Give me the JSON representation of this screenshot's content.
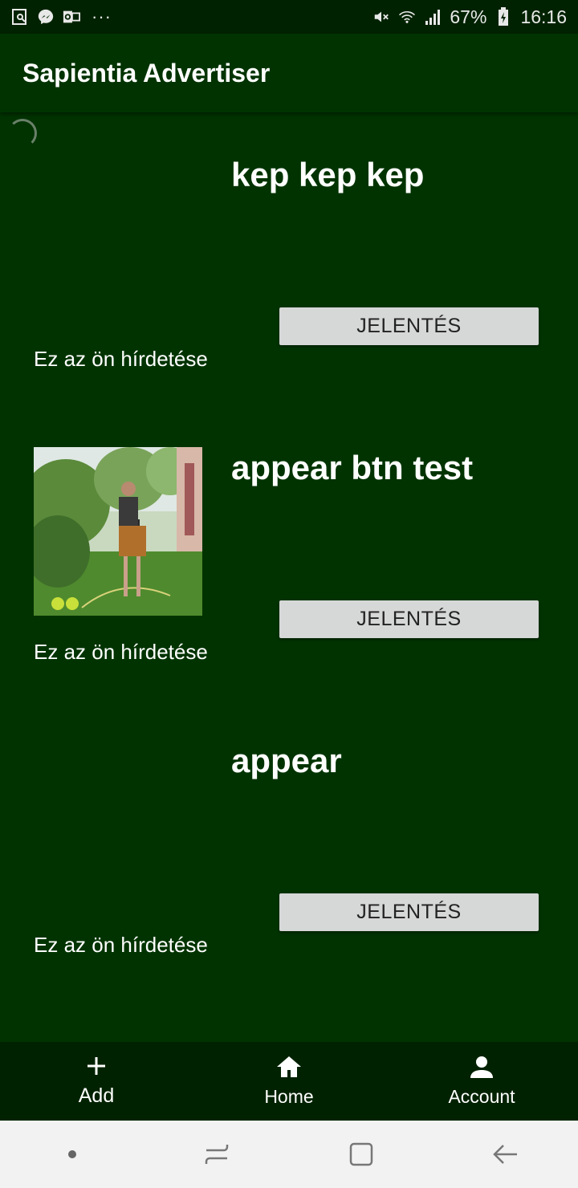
{
  "status_bar": {
    "battery": "67%",
    "time": "16:16",
    "more": "···",
    "left_icons": [
      "screenshot-icon",
      "messenger-icon",
      "outlook-icon"
    ],
    "right_icons": [
      "mute-icon",
      "wifi-icon",
      "signal-icon",
      "battery-icon"
    ]
  },
  "app_bar": {
    "title": "Sapientia Advertiser"
  },
  "ads": [
    {
      "title": "kep kep kep",
      "has_image": false,
      "report_label": "JELENTÉS",
      "owner_text": "Ez az ön hírdetése"
    },
    {
      "title": "appear btn test",
      "has_image": true,
      "image_desc": "photo-thumbnail",
      "report_label": "JELENTÉS",
      "owner_text": "Ez az ön hírdetése"
    },
    {
      "title": "appear",
      "has_image": false,
      "report_label": "JELENTÉS",
      "owner_text": "Ez az ön hírdetése"
    }
  ],
  "bottom_nav": {
    "add": {
      "label": "Add",
      "icon": "plus-icon"
    },
    "home": {
      "label": "Home",
      "icon": "home-icon"
    },
    "account": {
      "label": "Account",
      "icon": "person-icon"
    }
  },
  "system_nav": [
    "dot-icon",
    "recents-icon",
    "home-square-icon",
    "back-arrow-icon"
  ],
  "colors": {
    "primary": "#003300",
    "bars": "#002200",
    "button": "#d6d7d7"
  }
}
